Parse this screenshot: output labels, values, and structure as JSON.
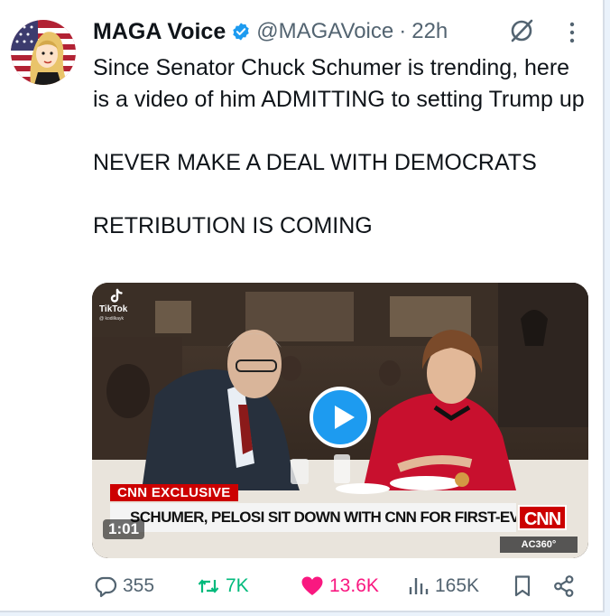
{
  "post": {
    "display_name": "MAGA Voice",
    "handle": "@MAGAVoice",
    "separator": "·",
    "time": "22h",
    "text_lines": [
      "Since Senator Chuck Schumer is trending, here is a video of him ADMITTING to setting Trump up",
      "NEVER MAKE A DEAL WITH DEMOCRATS",
      "RETRIBUTION IS COMING"
    ]
  },
  "media": {
    "watermark": "TikTok",
    "watermark_user": "@ kodilkayk",
    "banner_label": "CNN EXCLUSIVE",
    "chyron": "SCHUMER, PELOSI SIT DOWN WITH CNN FOR FIRST-EVER JOINT INTERVIEW",
    "network_logo": "CNN",
    "duration": "1:01",
    "show_tag": "AC360°"
  },
  "actions": {
    "replies": "355",
    "reposts": "7K",
    "likes": "13.6K",
    "views": "165K"
  },
  "colors": {
    "accent": "#1d9bf0",
    "repost": "#00ba7c",
    "like": "#f91880",
    "muted": "#536471",
    "cnn_red": "#cc0000"
  },
  "icons": {
    "verified": "verified-badge-icon",
    "grok": "grok-icon",
    "more": "more-dots-icon",
    "reply": "reply-icon",
    "repost": "repost-icon",
    "like": "heart-icon",
    "views": "views-chart-icon",
    "bookmark": "bookmark-icon",
    "share": "share-icon",
    "play": "play-icon"
  }
}
